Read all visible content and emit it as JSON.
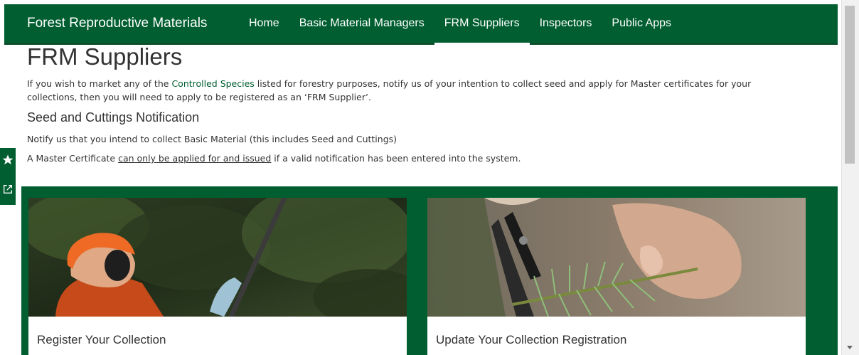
{
  "header": {
    "brand": "Forest Reproductive Materials",
    "nav": [
      {
        "label": "Home"
      },
      {
        "label": "Basic Material Managers"
      },
      {
        "label": "FRM Suppliers",
        "active": true
      },
      {
        "label": "Inspectors"
      },
      {
        "label": "Public Apps"
      }
    ]
  },
  "main": {
    "title": "FRM Suppliers",
    "intro_before": "If you wish to market any of the ",
    "intro_link": "Controlled Species",
    "intro_after": " listed for forestry purposes, notify us of your intention to collect seed and apply for Master certificates for your collections, then you will need to apply to be registered as an ‘FRM Supplier’.",
    "section_heading": "Seed and Cuttings Notification",
    "notify_text": "Notify us that you intend to collect Basic Material (this includes Seed and Cuttings)",
    "master_before": "A Master Certificate ",
    "master_underlined": "can only be applied for and issued",
    "master_after": " if a valid notification has been entered into the system."
  },
  "cards": [
    {
      "title": "Register Your Collection",
      "image": "forester-pruning-photo"
    },
    {
      "title": "Update Your Collection Registration",
      "image": "secateurs-cutting-photo"
    }
  ],
  "side_toolbar": {
    "icons": [
      "star-icon",
      "share-icon"
    ]
  },
  "colors": {
    "brand_green": "#005e30",
    "text": "#333333"
  }
}
